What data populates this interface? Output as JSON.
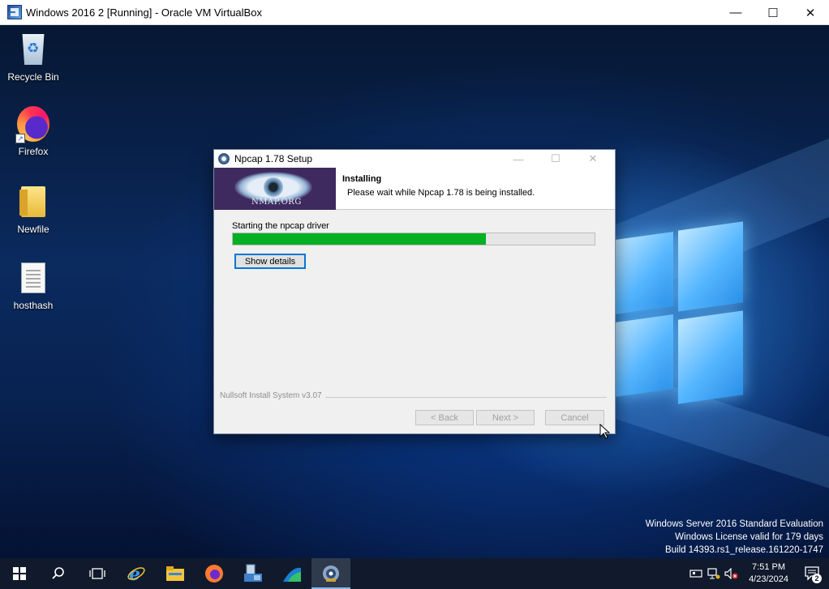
{
  "host_window": {
    "title": "Windows 2016 2 [Running] - Oracle VM VirtualBox",
    "minimize": "—",
    "maximize": "☐",
    "close": "✕"
  },
  "desktop": {
    "icons": [
      {
        "label": "Recycle Bin",
        "icon": "recycle-bin-icon"
      },
      {
        "label": "Firefox",
        "icon": "firefox-icon"
      },
      {
        "label": "Newfile",
        "icon": "folder-icon"
      },
      {
        "label": "hosthash",
        "icon": "text-file-icon"
      }
    ]
  },
  "dialog": {
    "title": "Npcap 1.78 Setup",
    "minimize": "—",
    "maximize": "☐",
    "close": "✕",
    "banner_text": "NMAP.ORG",
    "header_title": "Installing",
    "header_subtitle": "Please wait while Npcap 1.78 is being installed.",
    "status": "Starting the npcap driver",
    "progress": 0.7,
    "show_details": "Show details",
    "branding": "Nullsoft Install System v3.07",
    "back": "< Back",
    "next": "Next >",
    "cancel": "Cancel"
  },
  "watermark": {
    "line1": "Windows Server 2016 Standard Evaluation",
    "line2": "Windows License valid for 179 days",
    "line3": "Build 14393.rs1_release.161220-1747"
  },
  "taskbar": {
    "items": [
      "start-button",
      "search",
      "task-view",
      "internet-explorer",
      "file-explorer",
      "firefox",
      "server-manager",
      "wireshark",
      "npcap-setup"
    ],
    "time": "7:51 PM",
    "date": "4/23/2024",
    "notification_count": "2"
  },
  "colors": {
    "progress_green": "#06b025",
    "taskbar": "#101a2c"
  }
}
